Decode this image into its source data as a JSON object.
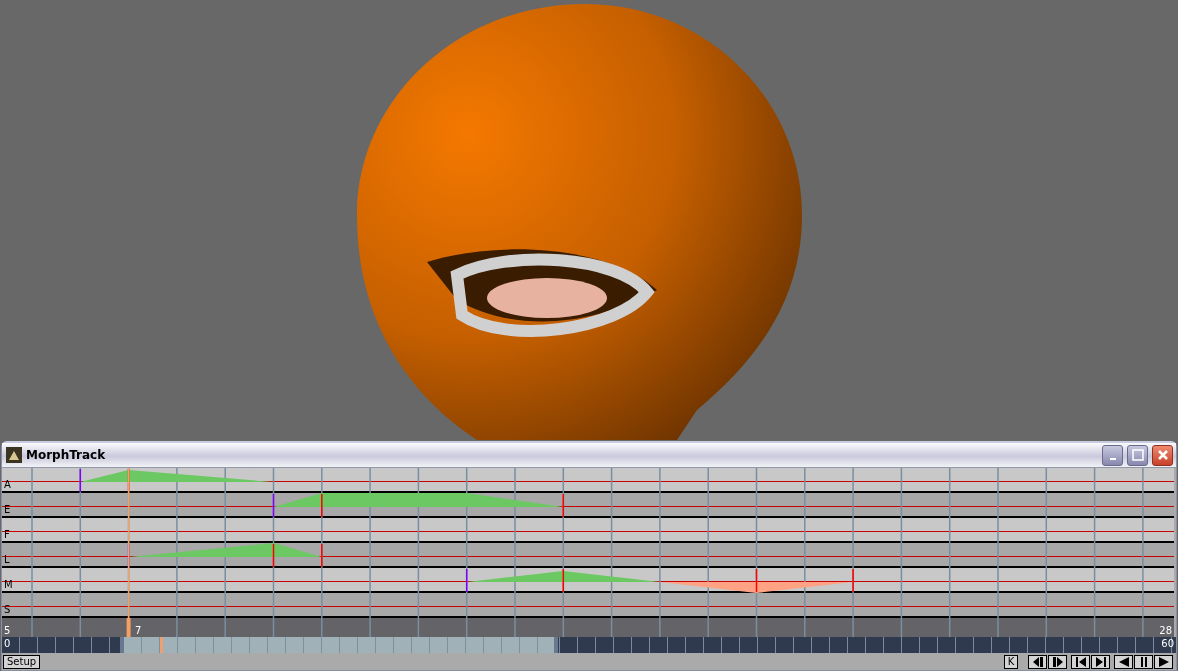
{
  "window": {
    "title": "MorphTrack"
  },
  "tracks": [
    {
      "label": "A"
    },
    {
      "label": "E"
    },
    {
      "label": "F"
    },
    {
      "label": "L"
    },
    {
      "label": "M"
    },
    {
      "label": "S"
    }
  ],
  "ruler": {
    "start": "5",
    "current": "7",
    "end": "28"
  },
  "scrub_bar": {
    "start": "0",
    "end": "60"
  },
  "buttons": {
    "setup": "Setup",
    "key": "K"
  }
}
